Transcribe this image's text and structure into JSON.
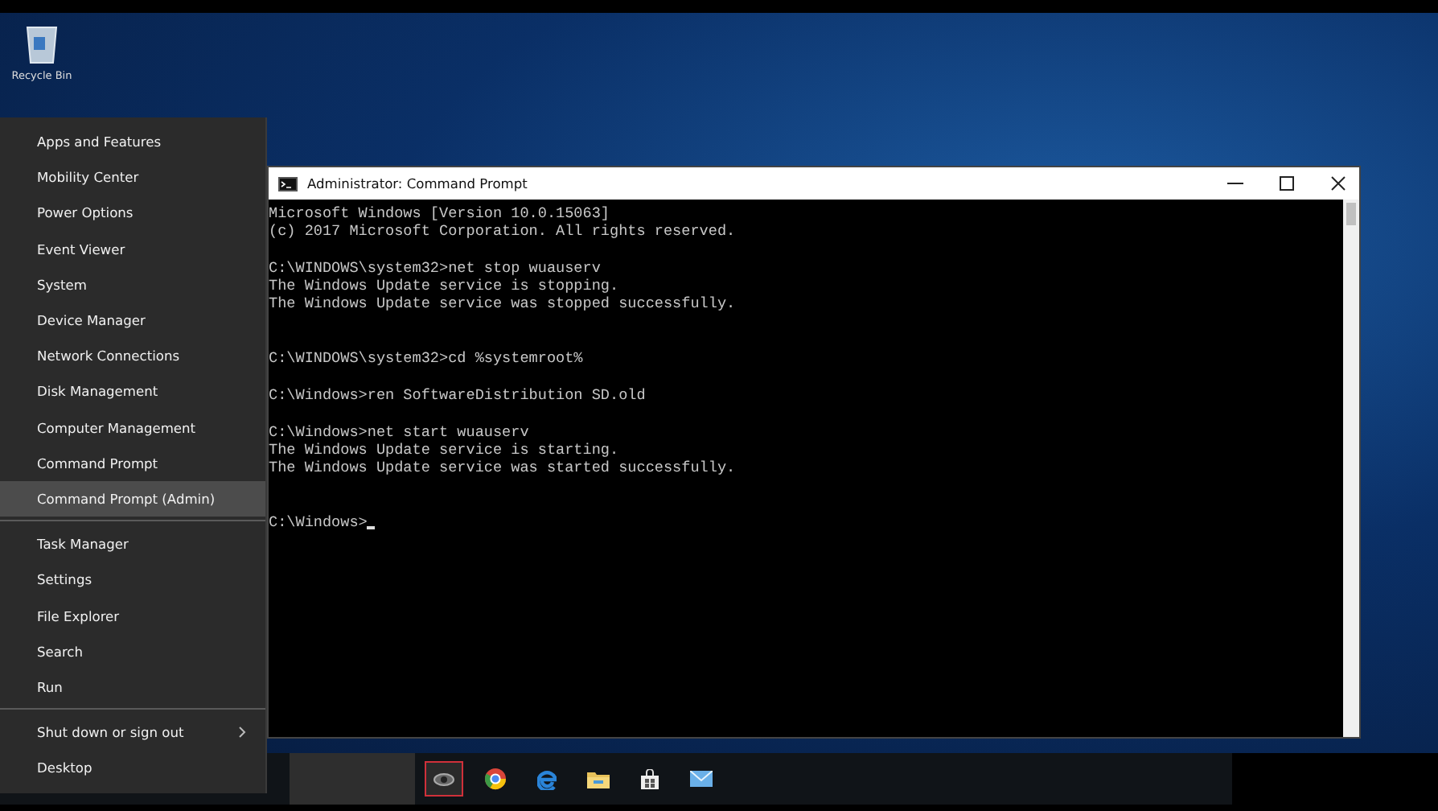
{
  "desktop": {
    "icons": [
      {
        "label": "Recycle Bin"
      }
    ]
  },
  "menu": {
    "groups": [
      [
        {
          "label": "Apps and Features",
          "selected": false,
          "submenu": false
        },
        {
          "label": "Mobility Center",
          "selected": false,
          "submenu": false
        },
        {
          "label": "Power Options",
          "selected": false,
          "submenu": false
        },
        {
          "label": "Event Viewer",
          "selected": false,
          "submenu": false
        },
        {
          "label": "System",
          "selected": false,
          "submenu": false
        },
        {
          "label": "Device Manager",
          "selected": false,
          "submenu": false
        },
        {
          "label": "Network Connections",
          "selected": false,
          "submenu": false
        },
        {
          "label": "Disk Management",
          "selected": false,
          "submenu": false
        },
        {
          "label": "Computer Management",
          "selected": false,
          "submenu": false
        },
        {
          "label": "Command Prompt",
          "selected": false,
          "submenu": false
        },
        {
          "label": "Command Prompt (Admin)",
          "selected": true,
          "submenu": false
        }
      ],
      [
        {
          "label": "Task Manager",
          "selected": false,
          "submenu": false
        },
        {
          "label": "Settings",
          "selected": false,
          "submenu": false
        },
        {
          "label": "File Explorer",
          "selected": false,
          "submenu": false
        },
        {
          "label": "Search",
          "selected": false,
          "submenu": false
        },
        {
          "label": "Run",
          "selected": false,
          "submenu": false
        }
      ],
      [
        {
          "label": "Shut down or sign out",
          "selected": false,
          "submenu": true
        },
        {
          "label": "Desktop",
          "selected": false,
          "submenu": false
        }
      ]
    ]
  },
  "window": {
    "title": "Administrator: Command Prompt",
    "lines": [
      {
        "kind": "text",
        "text": "Microsoft Windows [Version 10.0.15063]"
      },
      {
        "kind": "text",
        "text": "(c) 2017 Microsoft Corporation. All rights reserved."
      },
      {
        "kind": "blank"
      },
      {
        "kind": "text",
        "text": "C:\\WINDOWS\\system32>net stop wuauserv"
      },
      {
        "kind": "text",
        "text": "The Windows Update service is stopping."
      },
      {
        "kind": "text",
        "text": "The Windows Update service was stopped successfully."
      },
      {
        "kind": "blank"
      },
      {
        "kind": "blank"
      },
      {
        "kind": "text",
        "text": "C:\\WINDOWS\\system32>cd %systemroot%"
      },
      {
        "kind": "blank"
      },
      {
        "kind": "text",
        "text": "C:\\Windows>ren SoftwareDistribution SD.old"
      },
      {
        "kind": "blank"
      },
      {
        "kind": "text",
        "text": "C:\\Windows>net start wuauserv"
      },
      {
        "kind": "text",
        "text": "The Windows Update service is starting."
      },
      {
        "kind": "text",
        "text": "The Windows Update service was started successfully."
      },
      {
        "kind": "blank"
      },
      {
        "kind": "blank"
      },
      {
        "kind": "prompt",
        "text": "C:\\Windows>"
      }
    ]
  },
  "taskbar": {
    "items": [
      {
        "kind": "taskview",
        "selected": true
      },
      {
        "kind": "browser",
        "selected": false
      },
      {
        "kind": "edge",
        "selected": false
      },
      {
        "kind": "folder",
        "selected": false
      },
      {
        "kind": "store",
        "selected": false
      },
      {
        "kind": "mail",
        "selected": false
      }
    ]
  }
}
